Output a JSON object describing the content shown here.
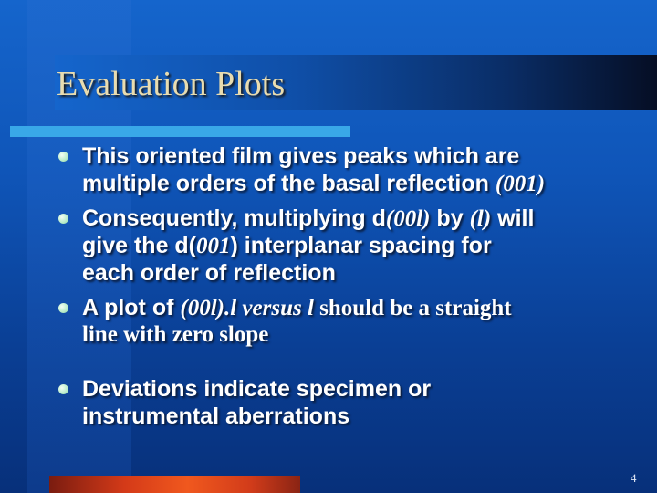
{
  "slide": {
    "title": "Evaluation Plots",
    "page_number": "4",
    "bullets": [
      {
        "line1_a": "This oriented film gives peaks which are",
        "line2_a": "multiple orders of the basal reflection ",
        "line2_b": "(001)"
      },
      {
        "line1_a": "Consequently, multiplying d",
        "line1_b": "(00l)",
        "line1_c": " by ",
        "line1_d": "(l)",
        "line1_e": " will",
        "line2_a": "give the d(",
        "line2_b": "001",
        "line2_c": ") interplanar spacing for",
        "line3_a": "each order of reflection"
      },
      {
        "line1_a": "A plot of ",
        "line1_b": "(00l).l versus l",
        "line1_c": " should be a straight",
        "line2_a": "line with zero slope"
      },
      {
        "line1_a": "Deviations indicate specimen or",
        "line2_a": "instrumental aberrations"
      }
    ],
    "colors": {
      "background": "#1565cc",
      "title_text": "#e8dcb0",
      "accent_bar": "#39a8e8",
      "bottom_bar": "#f0581e",
      "bullet_dot": "#b8ecc8"
    }
  }
}
